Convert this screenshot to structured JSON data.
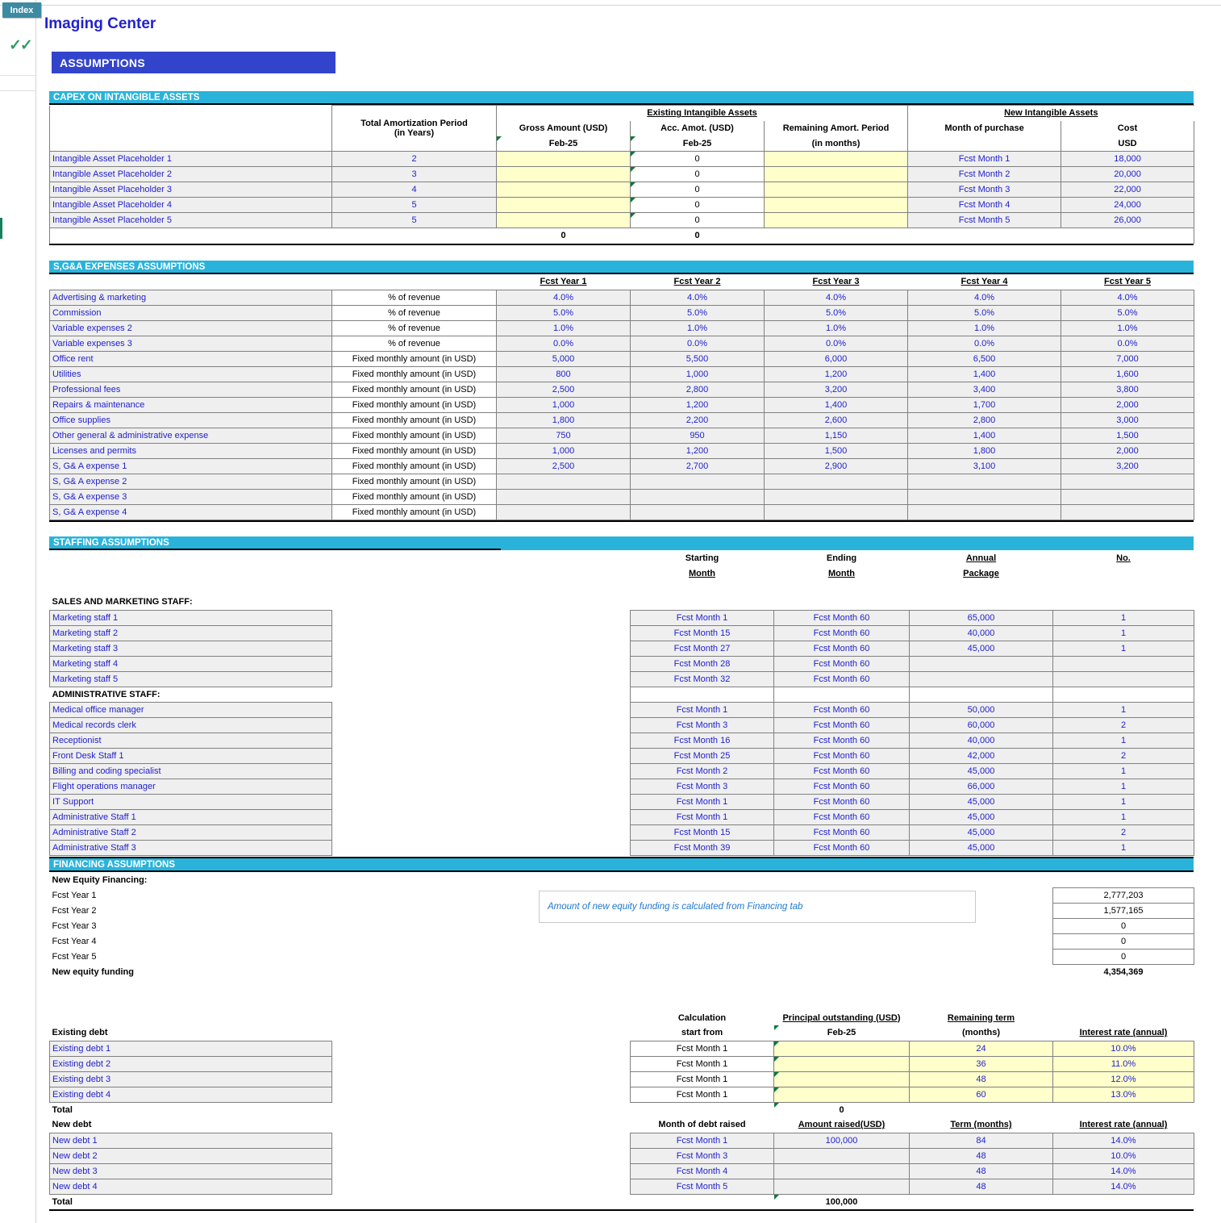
{
  "app": {
    "index_tab": "Index",
    "checkmarks": "✓✓",
    "page_title": "Imaging Center",
    "banner": "ASSUMPTIONS"
  },
  "capex": {
    "section_title": "CAPEX ON INTANGIBLE ASSETS",
    "group_existing": "Existing Intangible Assets",
    "group_new": "New Intangible Assets",
    "headers": {
      "amort_l1": "Total Amortization Period",
      "amort_l2": "(in Years)",
      "gross_l1": "Gross Amount (USD)",
      "gross_l2": "Feb-25",
      "acc_l1": "Acc. Amot. (USD)",
      "acc_l2": "Feb-25",
      "rem_l1": "Remaining Amort. Period",
      "rem_l2": "(in months)",
      "month_l1": "Month of purchase",
      "cost_l1": "Cost",
      "cost_l2": "USD"
    },
    "rows": [
      {
        "name": "Intangible Asset Placeholder 1",
        "years": "2",
        "gross": "",
        "acc": "0",
        "remaining": "",
        "month": "Fcst Month 1",
        "cost": "18,000"
      },
      {
        "name": "Intangible Asset Placeholder 2",
        "years": "3",
        "gross": "",
        "acc": "0",
        "remaining": "",
        "month": "Fcst Month 2",
        "cost": "20,000"
      },
      {
        "name": "Intangible Asset Placeholder 3",
        "years": "4",
        "gross": "",
        "acc": "0",
        "remaining": "",
        "month": "Fcst Month 3",
        "cost": "22,000"
      },
      {
        "name": "Intangible Asset Placeholder 4",
        "years": "5",
        "gross": "",
        "acc": "0",
        "remaining": "",
        "month": "Fcst Month 4",
        "cost": "24,000"
      },
      {
        "name": "Intangible Asset Placeholder 5",
        "years": "5",
        "gross": "",
        "acc": "0",
        "remaining": "",
        "month": "Fcst Month 5",
        "cost": "26,000"
      }
    ],
    "total": {
      "gross": "0",
      "acc": "0"
    }
  },
  "sga": {
    "section_title": "S,G&A EXPENSES ASSUMPTIONS",
    "year_headers": [
      "Fcst Year 1",
      "Fcst Year 2",
      "Fcst Year 3",
      "Fcst Year 4",
      "Fcst Year 5"
    ],
    "rows": [
      {
        "name": "Advertising & marketing",
        "basis": "% of revenue",
        "values": [
          "4.0%",
          "4.0%",
          "4.0%",
          "4.0%",
          "4.0%"
        ]
      },
      {
        "name": "Commission",
        "basis": "% of revenue",
        "values": [
          "5.0%",
          "5.0%",
          "5.0%",
          "5.0%",
          "5.0%"
        ]
      },
      {
        "name": "Variable expenses 2",
        "basis": "% of revenue",
        "values": [
          "1.0%",
          "1.0%",
          "1.0%",
          "1.0%",
          "1.0%"
        ]
      },
      {
        "name": "Variable expenses 3",
        "basis": "% of revenue",
        "values": [
          "0.0%",
          "0.0%",
          "0.0%",
          "0.0%",
          "0.0%"
        ]
      },
      {
        "name": "Office rent",
        "basis": "Fixed monthly amount (in USD)",
        "values": [
          "5,000",
          "5,500",
          "6,000",
          "6,500",
          "7,000"
        ]
      },
      {
        "name": "Utilities",
        "basis": "Fixed monthly amount (in USD)",
        "values": [
          "800",
          "1,000",
          "1,200",
          "1,400",
          "1,600"
        ]
      },
      {
        "name": "Professional fees",
        "basis": "Fixed monthly amount (in USD)",
        "values": [
          "2,500",
          "2,800",
          "3,200",
          "3,400",
          "3,800"
        ]
      },
      {
        "name": "Repairs & maintenance",
        "basis": "Fixed monthly amount (in USD)",
        "values": [
          "1,000",
          "1,200",
          "1,400",
          "1,700",
          "2,000"
        ]
      },
      {
        "name": "Office supplies",
        "basis": "Fixed monthly amount (in USD)",
        "values": [
          "1,800",
          "2,200",
          "2,600",
          "2,800",
          "3,000"
        ]
      },
      {
        "name": "Other general & administrative expense",
        "basis": "Fixed monthly amount (in USD)",
        "values": [
          "750",
          "950",
          "1,150",
          "1,400",
          "1,500"
        ]
      },
      {
        "name": "Licenses and permits",
        "basis": "Fixed monthly amount (in USD)",
        "values": [
          "1,000",
          "1,200",
          "1,500",
          "1,800",
          "2,000"
        ]
      },
      {
        "name": "S, G& A expense 1",
        "basis": "Fixed monthly amount (in USD)",
        "values": [
          "2,500",
          "2,700",
          "2,900",
          "3,100",
          "3,200"
        ]
      },
      {
        "name": "S, G& A expense 2",
        "basis": "Fixed monthly amount (in USD)",
        "values": [
          "",
          "",
          "",
          "",
          ""
        ]
      },
      {
        "name": "S, G& A expense 3",
        "basis": "Fixed monthly amount (in USD)",
        "values": [
          "",
          "",
          "",
          "",
          ""
        ]
      },
      {
        "name": "S, G& A expense 4",
        "basis": "Fixed monthly amount (in USD)",
        "values": [
          "",
          "",
          "",
          "",
          ""
        ]
      }
    ]
  },
  "staffing": {
    "section_title": "STAFFING ASSUMPTIONS",
    "headers": {
      "start_l1": "Starting",
      "start_l2": "Month",
      "end_l1": "Ending",
      "end_l2": "Month",
      "pkg_l1": "Annual",
      "pkg_l2": "Package",
      "no_l1": "No."
    },
    "group_sales": "SALES AND MARKETING STAFF:",
    "group_admin": "ADMINISTRATIVE STAFF:",
    "sales_rows": [
      {
        "name": "Marketing staff 1",
        "start": "Fcst Month 1",
        "end": "Fcst Month 60",
        "package": "65,000",
        "no": "1"
      },
      {
        "name": "Marketing staff 2",
        "start": "Fcst Month 15",
        "end": "Fcst Month 60",
        "package": "40,000",
        "no": "1"
      },
      {
        "name": "Marketing staff 3",
        "start": "Fcst Month 27",
        "end": "Fcst Month 60",
        "package": "45,000",
        "no": "1"
      },
      {
        "name": "Marketing staff 4",
        "start": "Fcst Month 28",
        "end": "Fcst Month 60",
        "package": "",
        "no": ""
      },
      {
        "name": "Marketing staff 5",
        "start": "Fcst Month 32",
        "end": "Fcst Month 60",
        "package": "",
        "no": ""
      }
    ],
    "admin_rows": [
      {
        "name": "Medical office manager",
        "start": "Fcst Month 1",
        "end": "Fcst Month 60",
        "package": "50,000",
        "no": "1"
      },
      {
        "name": "Medical records clerk",
        "start": "Fcst Month 3",
        "end": "Fcst Month 60",
        "package": "60,000",
        "no": "2"
      },
      {
        "name": "Receptionist",
        "start": "Fcst Month 16",
        "end": "Fcst Month 60",
        "package": "40,000",
        "no": "1"
      },
      {
        "name": "Front Desk Staff 1",
        "start": "Fcst Month 25",
        "end": "Fcst Month 60",
        "package": "42,000",
        "no": "2"
      },
      {
        "name": "Billing and coding specialist",
        "start": "Fcst Month 2",
        "end": "Fcst Month 60",
        "package": "45,000",
        "no": "1"
      },
      {
        "name": "Flight operations manager",
        "start": "Fcst Month 3",
        "end": "Fcst Month 60",
        "package": "66,000",
        "no": "1"
      },
      {
        "name": "IT Support",
        "start": "Fcst Month 1",
        "end": "Fcst Month 60",
        "package": "45,000",
        "no": "1"
      },
      {
        "name": "Administrative Staff 1",
        "start": "Fcst Month 1",
        "end": "Fcst Month 60",
        "package": "45,000",
        "no": "1"
      },
      {
        "name": "Administrative Staff 2",
        "start": "Fcst Month 15",
        "end": "Fcst Month 60",
        "package": "45,000",
        "no": "2"
      },
      {
        "name": "Administrative Staff 3",
        "start": "Fcst Month 39",
        "end": "Fcst Month 60",
        "package": "45,000",
        "no": "1"
      }
    ]
  },
  "financing": {
    "section_title": "FINANCING ASSUMPTIONS",
    "equity_title": "New Equity Financing:",
    "note": "Amount of new equity funding is calculated from Financing  tab",
    "equity_rows": [
      {
        "label": "Fcst Year 1",
        "value": "2,777,203"
      },
      {
        "label": "Fcst Year 2",
        "value": "1,577,165"
      },
      {
        "label": "Fcst Year 3",
        "value": "0"
      },
      {
        "label": "Fcst Year 4",
        "value": "0"
      },
      {
        "label": "Fcst Year 5",
        "value": "0"
      }
    ],
    "equity_total_label": "New equity funding",
    "equity_total_value": "4,354,369",
    "existing_debt_title": "Existing debt",
    "existing_headers": {
      "calc_l1": "Calculation",
      "calc_l2": "start from",
      "principal_l1": "Principal outstanding (USD)",
      "principal_l2": "Feb-25",
      "term_l1": "Remaining term",
      "term_l2": "(months)",
      "rate_l1": "Interest rate (annual)"
    },
    "existing_rows": [
      {
        "name": "Existing debt 1",
        "start": "Fcst Month 1",
        "principal": "",
        "term": "24",
        "rate": "10.0%"
      },
      {
        "name": "Existing debt 2",
        "start": "Fcst Month 1",
        "principal": "",
        "term": "36",
        "rate": "11.0%"
      },
      {
        "name": "Existing debt 3",
        "start": "Fcst Month 1",
        "principal": "",
        "term": "48",
        "rate": "12.0%"
      },
      {
        "name": "Existing debt 4",
        "start": "Fcst Month 1",
        "principal": "",
        "term": "60",
        "rate": "13.0%"
      }
    ],
    "existing_total_label": "Total",
    "existing_total_value": "0",
    "new_debt_title": "New debt",
    "new_headers": {
      "month": "Month of debt raised",
      "amount": "Amount raised(USD)",
      "term": "Term (months)",
      "rate": "Interest rate (annual)"
    },
    "new_rows": [
      {
        "name": "New debt 1",
        "month": "Fcst Month 1",
        "amount": "100,000",
        "term": "84",
        "rate": "14.0%"
      },
      {
        "name": "New debt 2",
        "month": "Fcst Month 3",
        "amount": "",
        "term": "48",
        "rate": "10.0%"
      },
      {
        "name": "New debt 3",
        "month": "Fcst Month 4",
        "amount": "",
        "term": "48",
        "rate": "14.0%"
      },
      {
        "name": "New debt 4",
        "month": "Fcst Month 5",
        "amount": "",
        "term": "48",
        "rate": "14.0%"
      }
    ],
    "new_total_label": "Total",
    "new_total_value": "100,000"
  },
  "colors": {
    "section_header": "#29b3db",
    "banner": "#3344cc",
    "title": "#2222cc",
    "input_blue": "#2222cc",
    "input_yellow": "#ffffcc",
    "index_tab": "#3d8ba3",
    "check_green": "#2e9e62"
  }
}
